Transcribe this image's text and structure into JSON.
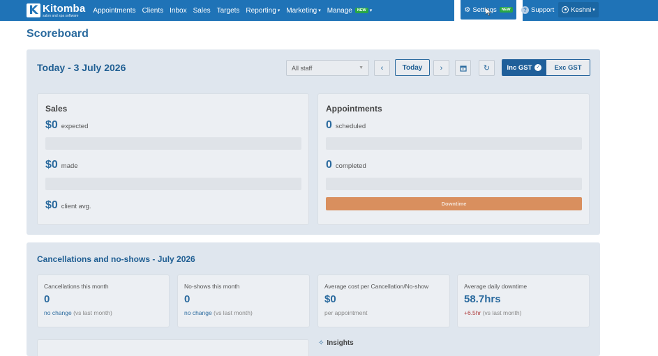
{
  "app": {
    "logo_name": "Kitomba",
    "logo_sub": "salon and spa software"
  },
  "nav": {
    "items": [
      {
        "label": "Appointments"
      },
      {
        "label": "Clients"
      },
      {
        "label": "Inbox"
      },
      {
        "label": "Sales"
      },
      {
        "label": "Targets"
      },
      {
        "label": "Reporting",
        "caret": "▾"
      },
      {
        "label": "Marketing",
        "caret": "▾"
      },
      {
        "label": "Manage",
        "caret": "▾",
        "badge": "NEW"
      }
    ],
    "settings_label": "Settings",
    "settings_badge": "NEW",
    "support_label": "Support",
    "user_label": "Keshni"
  },
  "page": {
    "title": "Scoreboard"
  },
  "scoreboard": {
    "day_title": "Today - 3 July 2026",
    "staff_select": "All staff",
    "prev_icon": "chevron-left-icon",
    "today_label": "Today",
    "next_icon": "chevron-right-icon",
    "calendar_icon": "calendar-icon",
    "refresh_icon": "refresh-icon",
    "inc_gst": "Inc GST",
    "exc_gst": "Exc GST"
  },
  "sales_card": {
    "title": "Sales",
    "expected_value": "$0",
    "expected_label": "expected",
    "made_value": "$0",
    "made_label": "made",
    "avg_value": "$0",
    "avg_label": "client avg."
  },
  "appointments_card": {
    "title": "Appointments",
    "scheduled_value": "0",
    "scheduled_label": "scheduled",
    "completed_value": "0",
    "completed_label": "completed",
    "downtime_label": "Downtime"
  },
  "cancellations": {
    "title": "Cancellations and no-shows - July 2026",
    "stats": [
      {
        "label": "Cancellations this month",
        "value": "0",
        "change": "no change",
        "suffix": "(vs last month)"
      },
      {
        "label": "No-shows this month",
        "value": "0",
        "change": "no change",
        "suffix": "(vs last month)"
      },
      {
        "label": "Average cost per Cancellation/No-show",
        "value": "$0",
        "change": "",
        "suffix": "per appointment"
      },
      {
        "label": "Average daily downtime",
        "value": "58.7hrs",
        "change": "+6.5hr",
        "suffix": "(vs last month)"
      }
    ]
  },
  "insights": {
    "label": "Insights"
  },
  "colors": {
    "primary": "#1f73b7",
    "accent_text": "#2a6a9e",
    "downtime_bar": "#d98f5e",
    "new_badge": "#28a745"
  }
}
